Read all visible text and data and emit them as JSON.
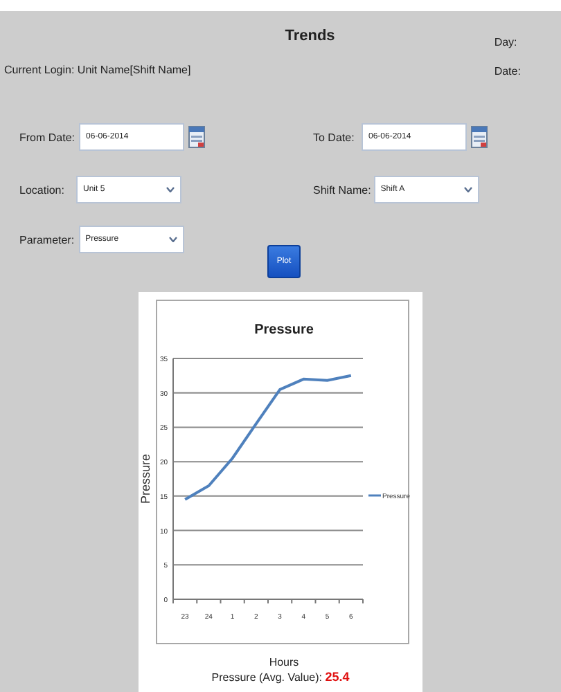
{
  "header": {
    "title": "Trends",
    "login": "Current Login: Unit Name[Shift Name]",
    "day_label": "Day:",
    "date_label": "Date:"
  },
  "form": {
    "from_date": {
      "label": "From Date:",
      "value": "06-06-2014"
    },
    "to_date": {
      "label": "To Date:",
      "value": "06-06-2014"
    },
    "location": {
      "label": "Location:",
      "value": "Unit 5"
    },
    "shift": {
      "label": "Shift Name:",
      "value": "Shift A"
    },
    "parameter": {
      "label": "Parameter:",
      "value": "Pressure"
    },
    "plot_button": "Plot"
  },
  "chart": {
    "chart_data": {
      "type": "line",
      "title": "Pressure",
      "xlabel": "Hours",
      "ylabel": "Pressure",
      "categories": [
        "23",
        "24",
        "1",
        "2",
        "3",
        "4",
        "5",
        "6"
      ],
      "series": [
        {
          "name": "Pressure",
          "color": "#4f81bd",
          "values": [
            14.5,
            16.5,
            20.5,
            25.5,
            30.5,
            32,
            31.8,
            32.5
          ]
        }
      ],
      "grid": true,
      "ylim": [
        0,
        35
      ],
      "yticks": [
        0,
        5,
        10,
        15,
        20,
        25,
        30,
        35
      ]
    }
  },
  "average": {
    "label": "Pressure (Avg. Value):",
    "value": "25.4"
  }
}
